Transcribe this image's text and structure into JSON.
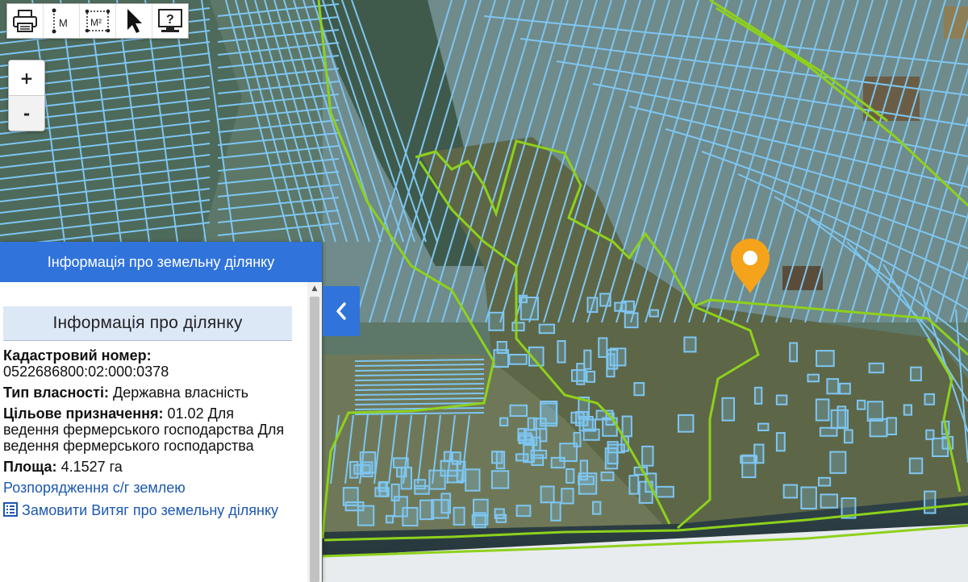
{
  "toolbar": {
    "print": {
      "icon": "printer-icon"
    },
    "measure_distance": {
      "icon": "measure-distance-icon",
      "label": "M"
    },
    "measure_area": {
      "icon": "measure-area-icon",
      "label": "M²"
    },
    "select": {
      "icon": "cursor-arrow-icon"
    },
    "info": {
      "icon": "info-monitor-icon",
      "label": "?"
    }
  },
  "zoom": {
    "in_label": "+",
    "out_label": "-"
  },
  "panel": {
    "header": "Інформація про земельну ділянку",
    "section_title": "Інформація про ділянку",
    "cadastral_label": "Кадастровий номер:",
    "cadastral_value": "0522686800:02:000:0378",
    "ownership_label": "Тип власності:",
    "ownership_value": "Державна власність",
    "purpose_label": "Цільове призначення:",
    "purpose_value": "01.02 Для ведення фермерського господарства Для ведення фермерського господарства",
    "area_label": "Площа:",
    "area_value": "4.1527 га",
    "link_disposal": "Розпорядження с/г землею",
    "link_order": "Замовити Витяг про земельну ділянку",
    "link_order_icon": "document-list-icon"
  },
  "collapse_icon": "chevron-left-icon",
  "marker_icon": "location-pin-icon",
  "colors": {
    "accent": "#3073db",
    "parcel_line": "#7ec6f2",
    "boundary_line": "#8ed11c",
    "marker": "#f5a31a"
  }
}
